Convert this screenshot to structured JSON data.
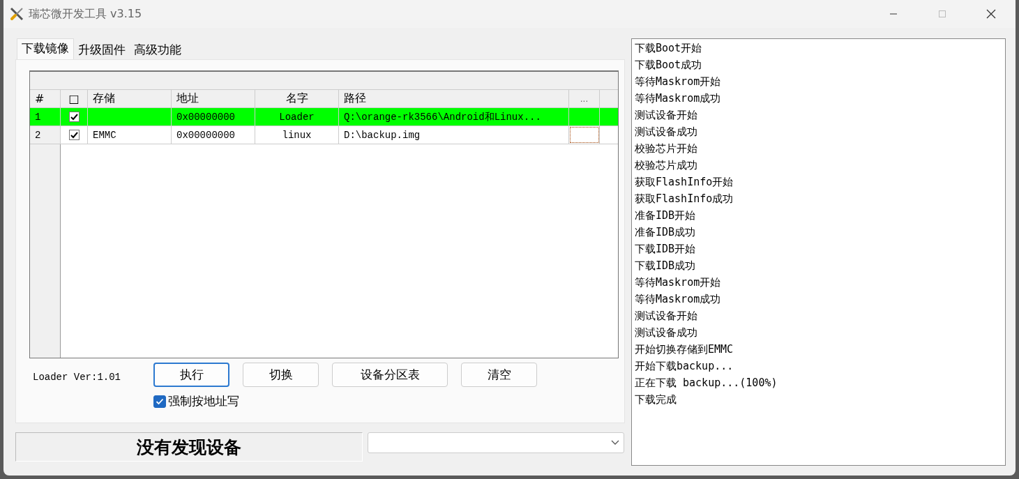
{
  "window": {
    "title": "瑞芯微开发工具 v3.15"
  },
  "tabs": [
    {
      "label": "下载镜像",
      "selected": true
    },
    {
      "label": "升级固件",
      "selected": false
    },
    {
      "label": "高级功能",
      "selected": false
    }
  ],
  "table": {
    "columns": [
      "#",
      "□",
      "存储",
      "地址",
      "名字",
      "路径",
      "..."
    ],
    "rows": [
      {
        "index": "1",
        "checked": true,
        "selected": true,
        "address": "0x00000000",
        "name": "Loader",
        "path": "Q:\\orange-rk3566\\Android和Linux...",
        "browse_focused": false
      },
      {
        "index": "2",
        "checked": true,
        "selected": false,
        "storage": "EMMC",
        "address": "0x00000000",
        "name": "linux",
        "path": "D:\\backup.img",
        "browse_focused": true
      }
    ]
  },
  "loader_version": "Loader Ver:1.01",
  "buttons": [
    {
      "label": "执行",
      "default": true
    },
    {
      "label": "切换",
      "default": false
    },
    {
      "label": "设备分区表",
      "default": false
    },
    {
      "label": "清空",
      "default": false
    }
  ],
  "force_address": {
    "label": "强制按地址写",
    "checked": true
  },
  "status": "没有发现设备",
  "log": [
    "下载Boot开始",
    "下载Boot成功",
    "等待Maskrom开始",
    "等待Maskrom成功",
    "测试设备开始",
    "测试设备成功",
    "校验芯片开始",
    "校验芯片成功",
    "获取FlashInfo开始",
    "获取FlashInfo成功",
    "准备IDB开始",
    "准备IDB成功",
    "下载IDB开始",
    "下载IDB成功",
    "等待Maskrom开始",
    "等待Maskrom成功",
    "测试设备开始",
    "测试设备成功",
    "开始切换存储到EMMC",
    "开始下载backup...",
    "正在下载 backup...(100%)",
    "下载完成"
  ]
}
